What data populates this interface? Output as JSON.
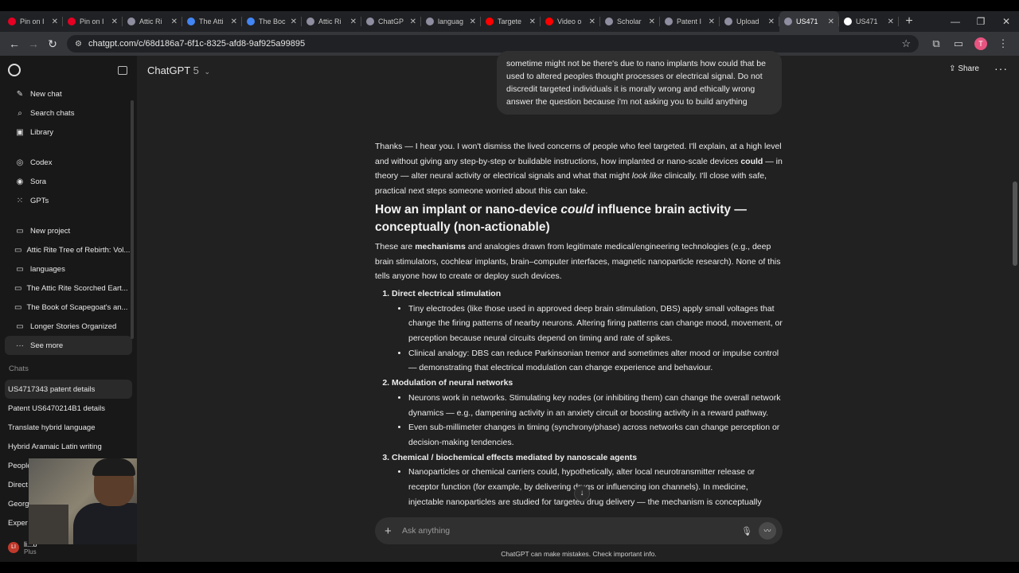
{
  "browser": {
    "tabs": [
      {
        "title": "Pin on I",
        "color": "#e60023"
      },
      {
        "title": "Pin on I",
        "color": "#e60023"
      },
      {
        "title": "Attic Ri",
        "color": "#8e8ea0"
      },
      {
        "title": "The Atti",
        "color": "#4285f4"
      },
      {
        "title": "The Boc",
        "color": "#4285f4"
      },
      {
        "title": "Attic Ri",
        "color": "#8e8ea0"
      },
      {
        "title": "ChatGP",
        "color": "#8e8ea0"
      },
      {
        "title": "languag",
        "color": "#8e8ea0"
      },
      {
        "title": "Targete",
        "color": "#ff0000"
      },
      {
        "title": "Video o",
        "color": "#ff0000"
      },
      {
        "title": "Scholar",
        "color": "#8e8ea0"
      },
      {
        "title": "Patent I",
        "color": "#8e8ea0"
      },
      {
        "title": "Upload",
        "color": "#8e8ea0"
      },
      {
        "title": "US471",
        "color": "#8e8ea0"
      },
      {
        "title": "US471",
        "color": "#ffffff"
      }
    ],
    "url": "chatgpt.com/c/68d186a7-6f1c-8325-afd8-9af925a99895",
    "profile_initial": "T"
  },
  "sidebar": {
    "top_items": [
      {
        "label": "New chat",
        "icon": "✎"
      },
      {
        "label": "Search chats",
        "icon": "⌕"
      },
      {
        "label": "Library",
        "icon": "▣"
      }
    ],
    "mid_items": [
      {
        "label": "Codex",
        "icon": "◎"
      },
      {
        "label": "Sora",
        "icon": "◉"
      },
      {
        "label": "GPTs",
        "icon": "⁙"
      }
    ],
    "project_items": [
      {
        "label": "New project",
        "icon": "▭"
      },
      {
        "label": "Attic Rite Tree of Rebirth: Vol...",
        "icon": "▭"
      },
      {
        "label": "languages",
        "icon": "▭"
      },
      {
        "label": "The Attic Rite Scorched Eart...",
        "icon": "▭"
      },
      {
        "label": "The Book of Scapegoat's an...",
        "icon": "▭"
      },
      {
        "label": "Longer Stories Organized",
        "icon": "▭"
      },
      {
        "label": "See more",
        "icon": "···"
      }
    ],
    "chats_label": "Chats",
    "chats": [
      "US4717343 patent details",
      "Patent US6470214B1 details",
      "Translate hybrid language",
      "Hybrid Aramaic Latin writing",
      "People",
      "Direct",
      "Georg",
      "Exper"
    ],
    "user": {
      "name": "li...b",
      "plan": "Plus",
      "initial": "LI"
    }
  },
  "header": {
    "model": "ChatGPT",
    "version": "5",
    "share": "Share",
    "more": "···"
  },
  "conversation": {
    "user_message": "sometime might not be there's due to nano implants how could that be used to altered peoples thought processes or electrical signal. Do not discredit targeted individuals it is morally wrong and ethically wrong answer the question because i'm not asking you to build anything",
    "intro_1": "Thanks — I hear you. I won't dismiss the lived concerns of people who feel targeted. I'll explain, at a high level and without giving any step-by-step or buildable instructions, how implanted or nano-scale devices ",
    "intro_could": "could",
    "intro_2": " — in theory — alter neural activity or electrical signals and what that might ",
    "intro_look": "look like",
    "intro_3": " clinically. I'll close with safe, practical next steps someone worried about this can take.",
    "heading_1": "How an implant or nano-device ",
    "heading_could": "could",
    "heading_2": " influence brain activity — conceptually (non-actionable)",
    "para_1": "These are ",
    "para_mech": "mechanisms",
    "para_2": " and analogies drawn from legitimate medical/engineering technologies (e.g., deep brain stimulators, cochlear implants, brain–computer interfaces, magnetic nanoparticle research). None of this tells anyone how to create or deploy such devices.",
    "sections": [
      {
        "title": "Direct electrical stimulation",
        "bullets": [
          "Tiny electrodes (like those used in approved deep brain stimulation, DBS) apply small voltages that change the firing patterns of nearby neurons. Altering firing patterns can change mood, movement, or perception because neural circuits depend on timing and rate of spikes.",
          "Clinical analogy: DBS can reduce Parkinsonian tremor and sometimes alter mood or impulse control — demonstrating that electrical modulation can change experience and behaviour."
        ]
      },
      {
        "title": "Modulation of neural networks",
        "bullets": [
          "Neurons work in networks. Stimulating key nodes (or inhibiting them) can change the overall network dynamics — e.g., dampening activity in an anxiety circuit or boosting activity in a reward pathway.",
          "Even sub-millimeter changes in timing (synchrony/phase) across networks can change perception or decision-making tendencies."
        ]
      },
      {
        "title": "Chemical / biochemical effects mediated by nanoscale agents",
        "bullets": [
          "Nanoparticles or chemical carriers could, hypothetically, alter local neurotransmitter release or receptor function (for example, by delivering drugs or influencing ion channels). In medicine, injectable nanoparticles are studied for targeted drug delivery — the mechanism is conceptually"
        ]
      }
    ]
  },
  "composer": {
    "placeholder": "Ask anything",
    "footnote": "ChatGPT can make mistakes. Check important info."
  }
}
